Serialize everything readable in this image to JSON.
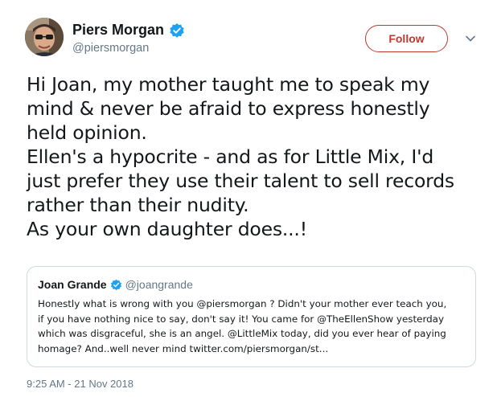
{
  "author": {
    "display_name": "Piers Morgan",
    "handle": "@piersmorgan",
    "verified_icon": "verified-badge-icon"
  },
  "actions": {
    "follow_label": "Follow",
    "menu_icon": "chevron-down-icon"
  },
  "tweet": {
    "lines": [
      "Hi Joan, my mother taught me to speak my",
      "mind & never be afraid to express honestly",
      "held opinion.",
      "Ellen's a hypocrite - and as for Little Mix, I'd",
      "just prefer they use their talent to sell records",
      "rather than their nudity.",
      "As your own daughter does...!"
    ]
  },
  "quoted_tweet": {
    "display_name": "Joan Grande",
    "handle": "@joangrande",
    "lines": [
      "Honestly what is wrong with you @piersmorgan ? Didn't your mother ever teach you,",
      "if you have nothing nice to say, don't say it! You came for @TheEllenShow yesterday",
      "which was disgraceful, she is an angel. @LittleMix today, did you ever hear of paying",
      "homage? And..well never mind twitter.com/piersmorgan/st..."
    ]
  },
  "timestamp": "9:25 AM - 21 Nov 2018",
  "colors": {
    "follow_accent": "#c0392b",
    "verified_blue": "#1da1f2",
    "secondary_text": "#657786",
    "border": "#cfd9de"
  }
}
